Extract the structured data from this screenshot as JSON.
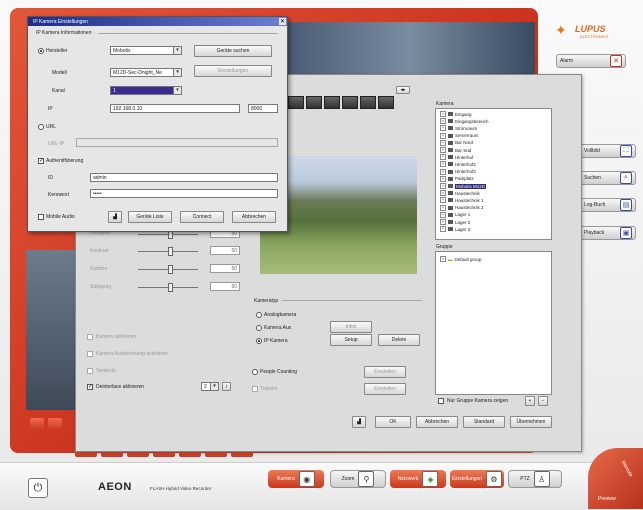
{
  "brand": {
    "logo": "LUPUS",
    "logo_sub": "ELECTRONICS",
    "product": "AEON",
    "product_sub": "FLASH  Hybrid Video Recorder"
  },
  "right_buttons": [
    "Alarm",
    "Vollbild",
    "Suchen",
    "Log-Buch",
    "Playback"
  ],
  "bottom_buttons": [
    "Kamera",
    "Zoom",
    "Netzwerk",
    "Einstellungen",
    "PTZ"
  ],
  "corner": {
    "remote": "Remote",
    "preview": "Preview"
  },
  "dialog": {
    "title": "IP Kamera Einstellungen",
    "group_title": "IP Kamera Informationen",
    "radio_model_label": "Hersteller",
    "manufacturer_value": "Mobotix",
    "model_label": "Modell",
    "model_value": "M12D-Sec-Dnight_Ne",
    "channel_label": "Kanal",
    "channel_value": "1",
    "ip_label": "IP",
    "ip_value": "192.168.0.10",
    "port_value": "8000",
    "url_label": "URL",
    "url_field_label": "URL-IP",
    "auth_label": "Authentifizierung",
    "user_label": "ID",
    "user_value": "admin",
    "password_label": "Kennwort",
    "password_value": "•••••",
    "search_btn": "Geräte suchen",
    "settings_btn": "Einstellungen",
    "mobile_label": "Mobile Audio",
    "search_list_btn": "Geräte Liste",
    "connect_btn": "Connect",
    "close_btn": "Abbrechen"
  },
  "main": {
    "sliders": [
      {
        "label": "Helligkeit",
        "value": "50"
      },
      {
        "label": "Kontrast",
        "value": "50"
      },
      {
        "label": "Farbton",
        "value": "50"
      },
      {
        "label": "Sättigung",
        "value": "50"
      }
    ],
    "checks": [
      {
        "label": "Kamera aktivieren",
        "checked": false,
        "disabled": true
      },
      {
        "label": "Kamera Aufzeichnung aktivieren",
        "checked": false,
        "disabled": true
      },
      {
        "label": "Verdeckt",
        "checked": false,
        "disabled": true
      },
      {
        "label": "Deinterlace aktivieren",
        "checked": true,
        "disabled": false
      }
    ],
    "deinterlace_value": "2",
    "kamera_group_label": "Kameratyp",
    "cam_types": [
      {
        "label": "Analogkamera",
        "on": false
      },
      {
        "label": "Kamera Aux",
        "on": false
      },
      {
        "label": "IP Kamera",
        "on": true
      }
    ],
    "cam_type_btns": [
      "Infos",
      "Setup",
      "Delete"
    ],
    "people_counting": "People Counting",
    "tripwire": "Tripwire",
    "people_btn": "Einstellen",
    "tripwire_btn": "Einstellen",
    "kamera_tree_title": "Kamera",
    "kamera_tree": [
      "Eingang",
      "Eingangsbereich",
      "Stromraum",
      "Serverraum",
      "Bar Nord",
      "Bar Süd",
      "Hinterhof",
      "Hinterhof2",
      "Hinterhof3",
      "Parkplatz",
      "Mobotix M12D",
      "Haustechnik",
      "Haustechnik 1",
      "Haustechnik 2",
      "Lager 1",
      "Lager 2",
      "Lager 3"
    ],
    "kamera_selected_index": 10,
    "group_tree_title": "Gruppe",
    "group_tree": [
      "Default group"
    ],
    "group_check_label": "Nur Gruppe Kamera zeigen",
    "bottom_btns": [
      "OK",
      "Abbrechen",
      "Standard",
      "Übernehmen"
    ]
  }
}
